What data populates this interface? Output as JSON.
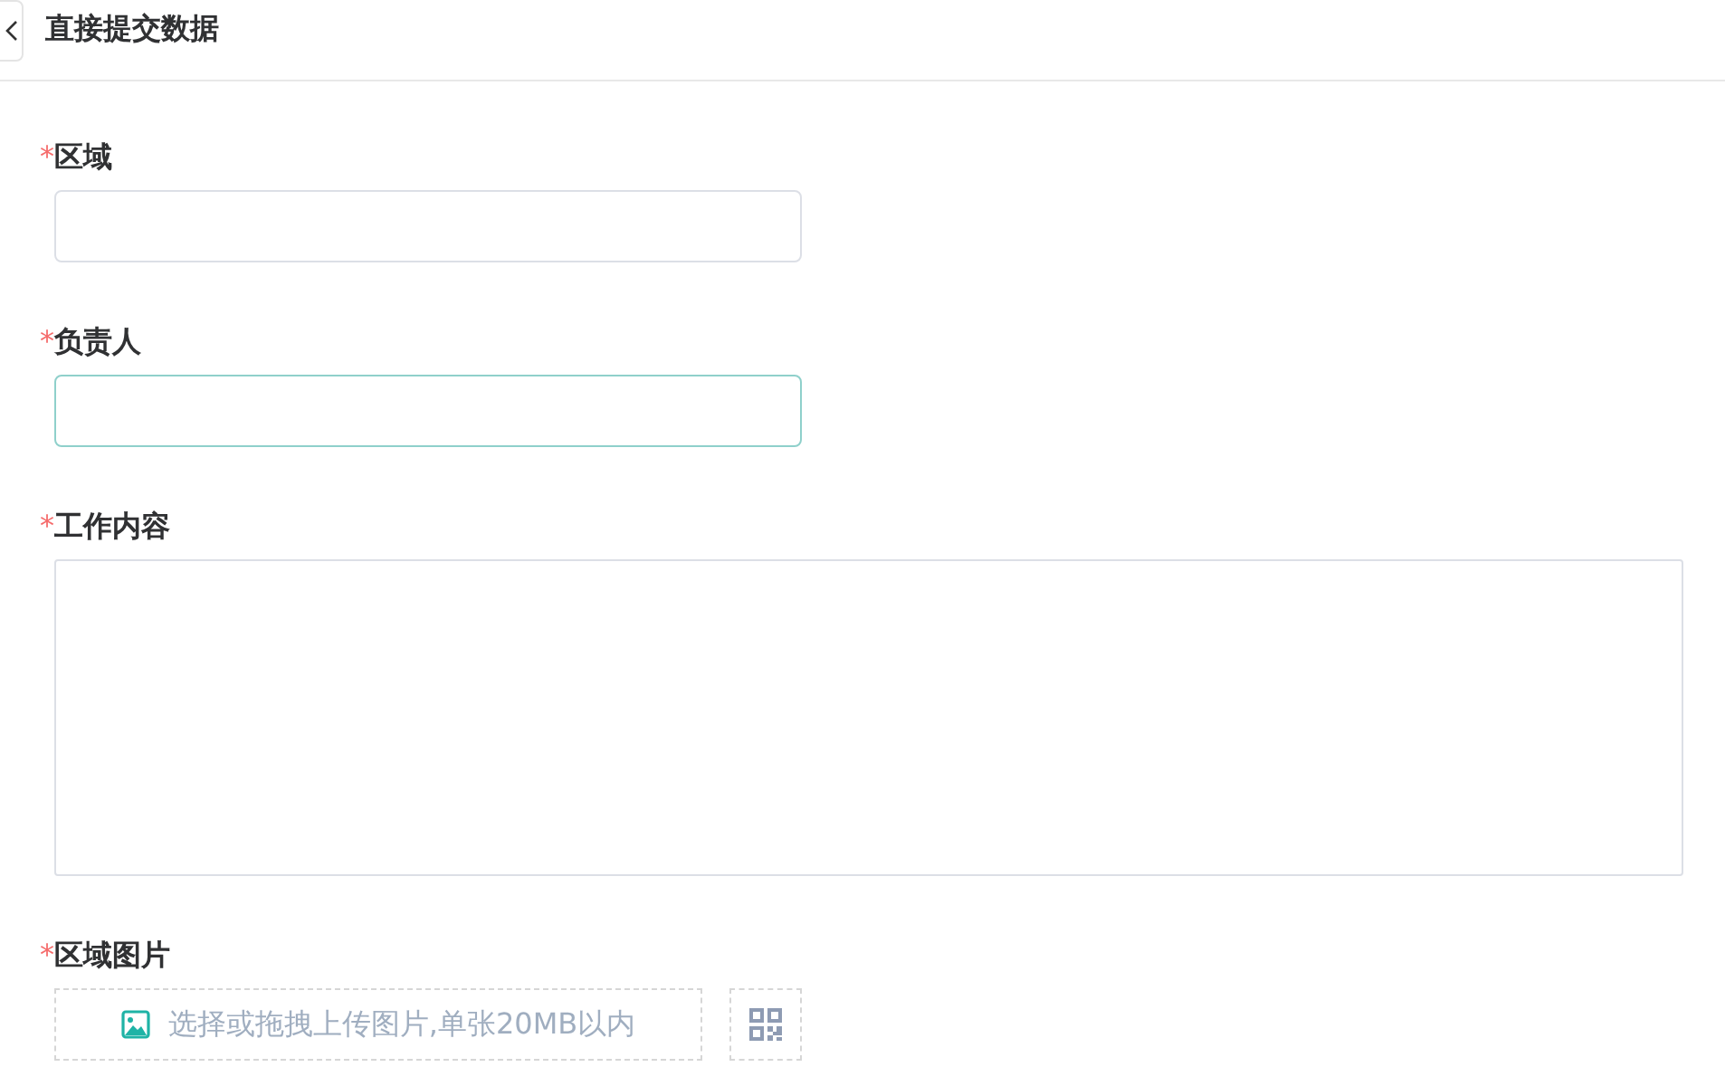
{
  "header": {
    "title": "直接提交数据"
  },
  "fields": [
    {
      "kind": "text",
      "marker": "*",
      "label": "区域",
      "focused": false
    },
    {
      "kind": "text",
      "marker": "*",
      "label": "负责人",
      "focused": true
    },
    {
      "kind": "textarea",
      "marker": "*",
      "label": "工作内容",
      "focused": false
    },
    {
      "kind": "upload",
      "marker": "*",
      "label": "区域图片",
      "focused": false,
      "hint": "选择或拖拽上传图片,单张20MB以内"
    }
  ]
}
